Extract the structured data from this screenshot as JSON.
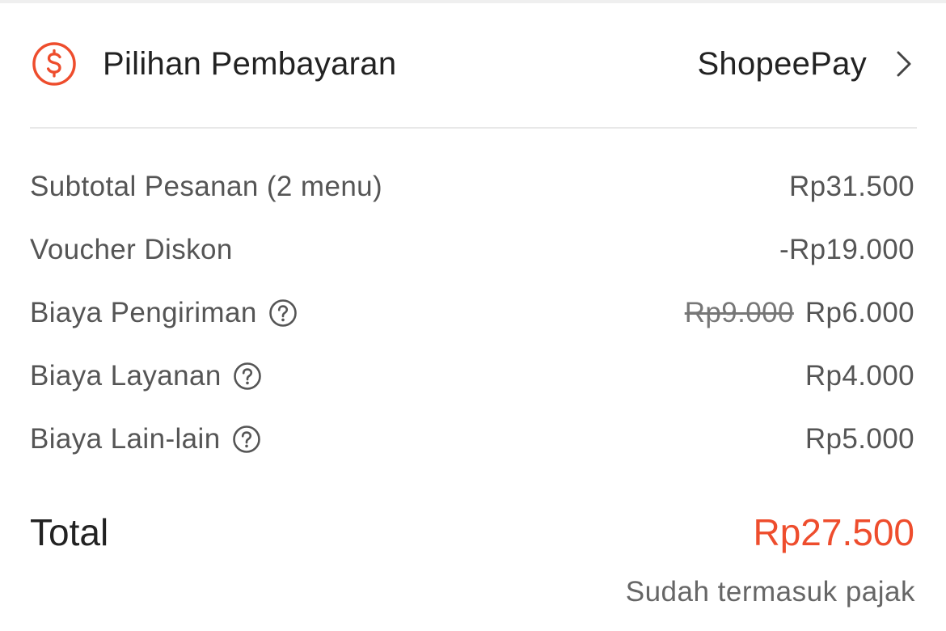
{
  "colors": {
    "accent": "#ee4d2d",
    "text_primary": "#222222",
    "text_secondary": "#555555",
    "divider": "#e8e8e8"
  },
  "payment": {
    "icon": "dollar-circle-icon",
    "label": "Pilihan Pembayaran",
    "value": "ShopeePay"
  },
  "items": [
    {
      "label": "Subtotal Pesanan (2 menu)",
      "value": "Rp31.500",
      "has_help": false
    },
    {
      "label": "Voucher Diskon",
      "value": "-Rp19.000",
      "has_help": false
    },
    {
      "label": "Biaya Pengiriman",
      "original_value": "Rp9.000",
      "value": "Rp6.000",
      "has_help": true
    },
    {
      "label": "Biaya Layanan",
      "value": "Rp4.000",
      "has_help": true
    },
    {
      "label": "Biaya Lain-lain",
      "value": "Rp5.000",
      "has_help": true
    }
  ],
  "total": {
    "label": "Total",
    "value": "Rp27.500",
    "note": "Sudah termasuk pajak"
  }
}
